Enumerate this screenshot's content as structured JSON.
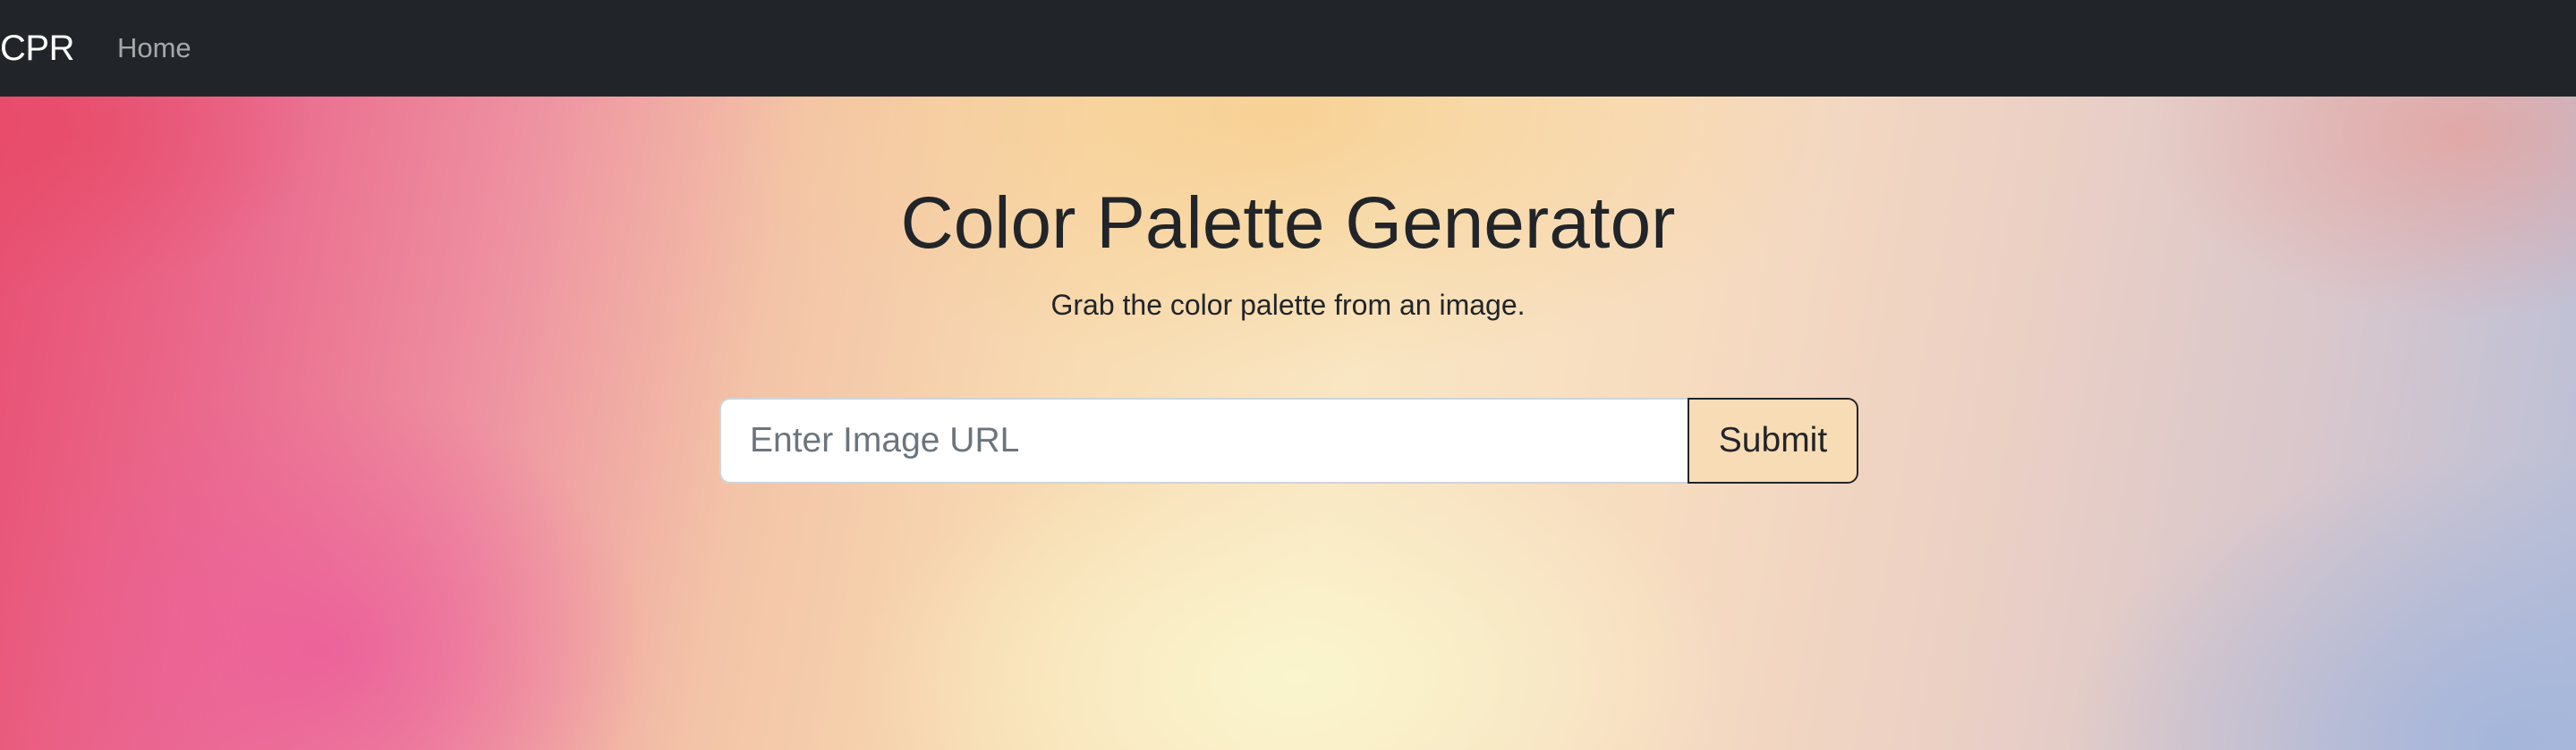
{
  "navbar": {
    "brand": "CPR",
    "links": [
      {
        "label": "Home"
      }
    ],
    "background": "#212529"
  },
  "hero": {
    "title": "Color Palette Generator",
    "subtitle": "Grab the color palette from an image."
  },
  "form": {
    "url_input": {
      "value": "",
      "placeholder": "Enter Image URL"
    },
    "submit_label": "Submit"
  }
}
